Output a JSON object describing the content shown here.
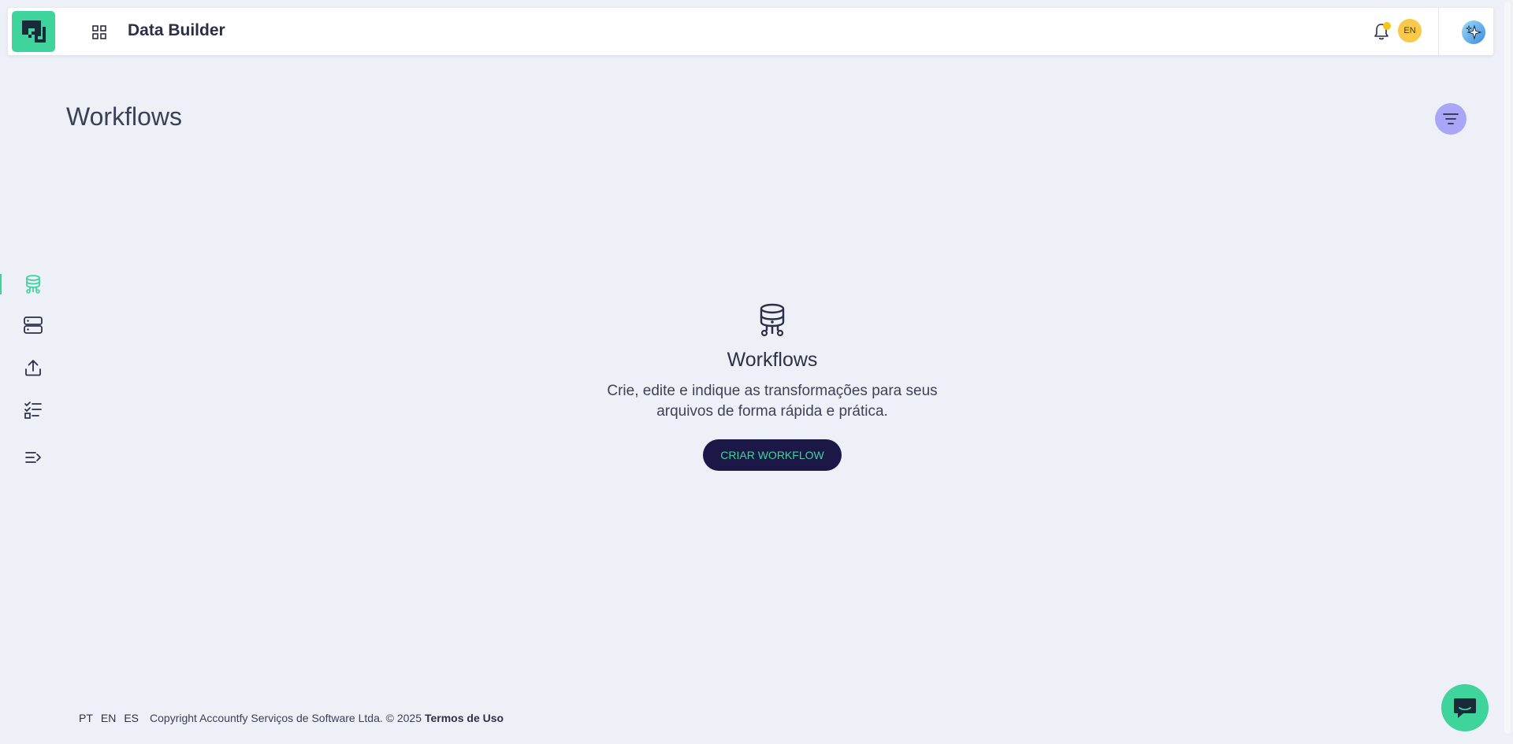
{
  "header": {
    "app_title": "Data Builder",
    "language_badge": "EN",
    "notification_dot_color": "#f5c518",
    "brand_color": "#3fd49b"
  },
  "sidebar": {
    "items": [
      {
        "name": "workflows",
        "icon": "workflow-database-icon",
        "active": true
      },
      {
        "name": "servers",
        "icon": "server-stack-icon",
        "active": false
      },
      {
        "name": "upload",
        "icon": "upload-icon",
        "active": false
      },
      {
        "name": "checklist",
        "icon": "checklist-icon",
        "active": false
      },
      {
        "name": "expand",
        "icon": "expand-menu-icon",
        "active": false
      }
    ]
  },
  "page": {
    "title": "Workflows"
  },
  "empty_state": {
    "title": "Workflows",
    "description": "Crie, edite e indique as transformações para seus arquivos de forma rápida e prática.",
    "button_label": "CRIAR WORKFLOW"
  },
  "footer": {
    "languages": [
      "PT",
      "EN",
      "ES"
    ],
    "copyright": "Copyright Accountfy Serviços de Software Ltda. © 2025",
    "terms_label": "Termos de Uso"
  }
}
